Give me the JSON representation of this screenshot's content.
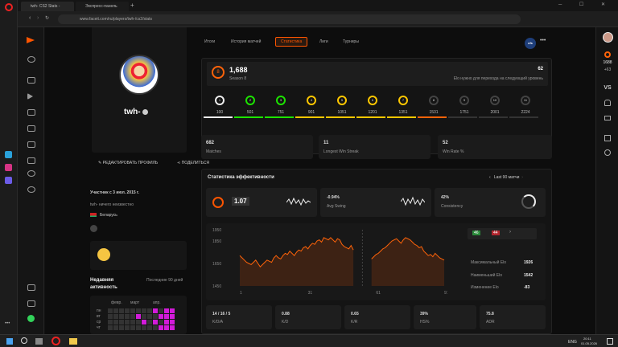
{
  "browser": {
    "tab1": "twh- CS2 Stats - FACEIT.com",
    "tab2": "Экспресс-панель",
    "url": "www.faceit.com/ru/players/twh-/cs2/stats"
  },
  "nav": {
    "tabs": [
      "Итоги",
      "История матчей",
      "Статистика",
      "Лиги",
      "Турниры"
    ],
    "active": 2,
    "badge": "cfs"
  },
  "profile": {
    "name": "twh-",
    "edit": "РЕДАКТИРОВАТЬ ПРОФИЛЬ",
    "share": "ПОДЕЛИТЬСЯ",
    "joined": "Участник с 3 июл. 2015 г.",
    "bio": "twh- ничего неизвестно",
    "country": "Беларусь",
    "activity_title": "Недавняя активность",
    "activity_range": "Последние 90 дней",
    "months": [
      "февр.",
      "март",
      "апр."
    ],
    "days": [
      "пн",
      "вт",
      "ср",
      "чт"
    ]
  },
  "elo": {
    "value": "1,688",
    "season": "Season 8",
    "needed_value": "62",
    "needed_label": "Elo нужно для перехода на следующий уровень",
    "level": "8",
    "levels": [
      "100",
      "501",
      "751",
      "901",
      "1051",
      "1201",
      "1351",
      "1531",
      "1751",
      "2001",
      "2224"
    ],
    "level_colors": [
      "#eeeeee",
      "#1ce400",
      "#1ce400",
      "#ffc800",
      "#ffc800",
      "#ffc800",
      "#ffc800",
      "#ff6309",
      "#ff6309",
      "#fe1f00",
      "#fe1f00"
    ]
  },
  "top": [
    {
      "v": "682",
      "l": "Matches"
    },
    {
      "v": "11",
      "l": "Longest Win Streak"
    },
    {
      "v": "52",
      "l": "Win Rate %"
    }
  ],
  "perf": {
    "title": "Статистика эффективности",
    "period": "Last 90 матчи",
    "rating": "1.07",
    "swing_v": "-0.94%",
    "swing_l": "Avg Swing",
    "cons_v": "42%",
    "cons_l": "Consistency"
  },
  "chart_data": {
    "type": "line",
    "ylim": [
      1450,
      1950
    ],
    "yticks": [
      "1950",
      "1850",
      "1650",
      "1450"
    ],
    "xticks": [
      "1",
      "31",
      "61",
      "91"
    ],
    "y": [
      1720,
      1700,
      1680,
      1660,
      1650,
      1640,
      1660,
      1680,
      1650,
      1620,
      1640,
      1660,
      1680,
      1670,
      1660,
      1700,
      1720,
      1700,
      1690,
      1720,
      1740,
      1730,
      1760,
      1740,
      1720,
      1750,
      1770,
      1760,
      1790,
      1800,
      1780,
      1810,
      1830,
      1820,
      1850,
      1860,
      1840,
      1880,
      1870,
      1860,
      1880,
      1860,
      1840,
      1870,
      1860,
      1820,
      1800,
      1790,
      1780,
      1810,
      1770,
      1740,
      1720,
      1700,
      1680,
      1660,
      1640,
      1680,
      1690,
      1710,
      1730,
      1740,
      1760,
      1780,
      1790,
      1810,
      1830,
      1850,
      1860,
      1870,
      1850,
      1830,
      1860,
      1880,
      1870,
      1860,
      1840,
      1820,
      1810,
      1790,
      1800,
      1760,
      1740,
      1720,
      1730,
      1710,
      1740,
      1720,
      1700,
      1690,
      1680
    ],
    "gap_range": [
      50,
      58
    ]
  },
  "streak": {
    "w": "46",
    "l": "44",
    "arrow": "›"
  },
  "elostats": [
    {
      "l": "Максимальный Elo",
      "v": "1926"
    },
    {
      "l": "Наименьший Elo",
      "v": "1542"
    },
    {
      "l": "Изменение Elo",
      "v": "-83"
    }
  ],
  "bottom": [
    {
      "v": "14 / 16 / 5",
      "l": "K/D/A"
    },
    {
      "v": "0.88",
      "l": "K/D"
    },
    {
      "v": "0.65",
      "l": "K/R"
    },
    {
      "v": "39%",
      "l": "HS%"
    },
    {
      "v": "75.8",
      "l": "ADR"
    }
  ],
  "right": {
    "elo": "1688",
    "gain": "+63",
    "vs": "VS"
  },
  "taskbar": {
    "lang": "ENG",
    "time": "20:11",
    "date": "01.05.2026"
  }
}
